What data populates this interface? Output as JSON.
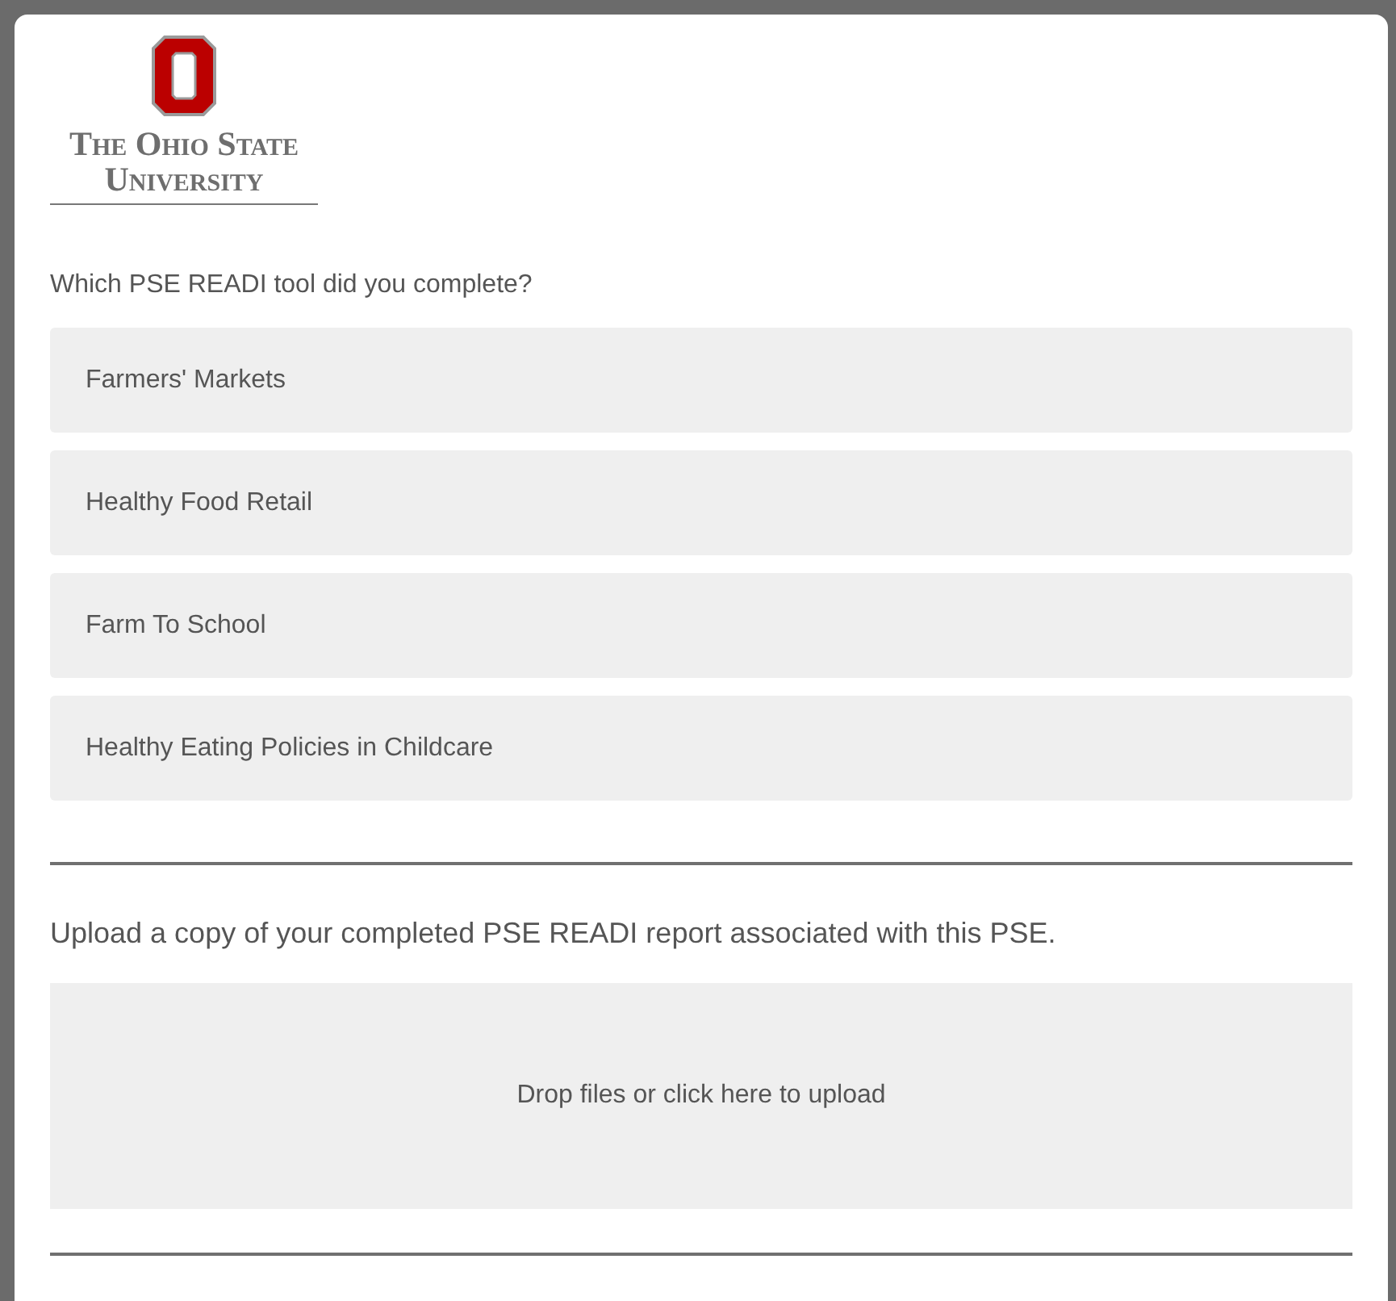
{
  "logo": {
    "line_1": "The Ohio State",
    "line_2": "University"
  },
  "question_1": {
    "prompt": "Which PSE READI tool did you complete?",
    "options": [
      {
        "label": "Farmers' Markets",
        "selected": false
      },
      {
        "label": "Healthy Food Retail",
        "selected": false
      },
      {
        "label": "Farm To School",
        "selected": false
      },
      {
        "label": "Healthy Eating Policies in Childcare",
        "selected": false
      }
    ]
  },
  "question_2": {
    "prompt": "Upload a copy of your completed PSE READI report associated with this PSE.",
    "dropzone": "Drop files or click here to upload"
  }
}
